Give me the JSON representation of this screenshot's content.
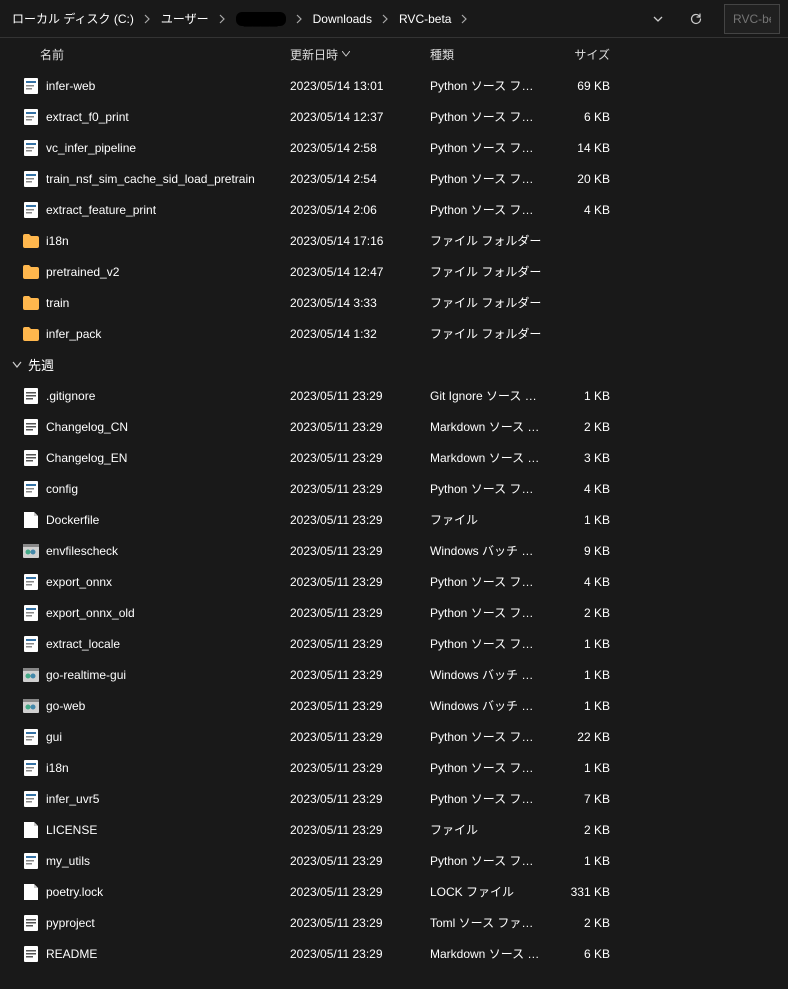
{
  "breadcrumb": [
    {
      "label": "ローカル ディスク (C:)"
    },
    {
      "label": "ユーザー"
    },
    {
      "label": "████",
      "hidden": true
    },
    {
      "label": "Downloads"
    },
    {
      "label": "RVC-beta"
    }
  ],
  "search_placeholder": "RVC-beta",
  "columns": {
    "name": "名前",
    "date": "更新日時",
    "type": "種類",
    "size": "サイズ"
  },
  "groups": [
    {
      "label": null,
      "items": [
        {
          "icon": "py",
          "name": "infer-web",
          "date": "2023/05/14 13:01",
          "type": "Python ソース ファイル",
          "size": "69 KB"
        },
        {
          "icon": "py",
          "name": "extract_f0_print",
          "date": "2023/05/14 12:37",
          "type": "Python ソース ファイル",
          "size": "6 KB"
        },
        {
          "icon": "py",
          "name": "vc_infer_pipeline",
          "date": "2023/05/14 2:58",
          "type": "Python ソース ファイル",
          "size": "14 KB"
        },
        {
          "icon": "py",
          "name": "train_nsf_sim_cache_sid_load_pretrain",
          "date": "2023/05/14 2:54",
          "type": "Python ソース ファイル",
          "size": "20 KB"
        },
        {
          "icon": "py",
          "name": "extract_feature_print",
          "date": "2023/05/14 2:06",
          "type": "Python ソース ファイル",
          "size": "4 KB"
        },
        {
          "icon": "folder",
          "name": "i18n",
          "date": "2023/05/14 17:16",
          "type": "ファイル フォルダー",
          "size": ""
        },
        {
          "icon": "folder",
          "name": "pretrained_v2",
          "date": "2023/05/14 12:47",
          "type": "ファイル フォルダー",
          "size": ""
        },
        {
          "icon": "folder",
          "name": "train",
          "date": "2023/05/14 3:33",
          "type": "ファイル フォルダー",
          "size": ""
        },
        {
          "icon": "folder",
          "name": "infer_pack",
          "date": "2023/05/14 1:32",
          "type": "ファイル フォルダー",
          "size": ""
        }
      ]
    },
    {
      "label": "先週",
      "items": [
        {
          "icon": "git",
          "name": ".gitignore",
          "date": "2023/05/11 23:29",
          "type": "Git Ignore ソース フ…",
          "size": "1 KB"
        },
        {
          "icon": "md",
          "name": "Changelog_CN",
          "date": "2023/05/11 23:29",
          "type": "Markdown ソース フ…",
          "size": "2 KB"
        },
        {
          "icon": "md",
          "name": "Changelog_EN",
          "date": "2023/05/11 23:29",
          "type": "Markdown ソース フ…",
          "size": "3 KB"
        },
        {
          "icon": "py",
          "name": "config",
          "date": "2023/05/11 23:29",
          "type": "Python ソース ファイル",
          "size": "4 KB"
        },
        {
          "icon": "file",
          "name": "Dockerfile",
          "date": "2023/05/11 23:29",
          "type": "ファイル",
          "size": "1 KB"
        },
        {
          "icon": "bat",
          "name": "envfilescheck",
          "date": "2023/05/11 23:29",
          "type": "Windows バッチ ファ…",
          "size": "9 KB"
        },
        {
          "icon": "py",
          "name": "export_onnx",
          "date": "2023/05/11 23:29",
          "type": "Python ソース ファイル",
          "size": "4 KB"
        },
        {
          "icon": "py",
          "name": "export_onnx_old",
          "date": "2023/05/11 23:29",
          "type": "Python ソース ファイル",
          "size": "2 KB"
        },
        {
          "icon": "py",
          "name": "extract_locale",
          "date": "2023/05/11 23:29",
          "type": "Python ソース ファイル",
          "size": "1 KB"
        },
        {
          "icon": "bat",
          "name": "go-realtime-gui",
          "date": "2023/05/11 23:29",
          "type": "Windows バッチ ファ…",
          "size": "1 KB"
        },
        {
          "icon": "bat",
          "name": "go-web",
          "date": "2023/05/11 23:29",
          "type": "Windows バッチ ファ…",
          "size": "1 KB",
          "highlight": true
        },
        {
          "icon": "py",
          "name": "gui",
          "date": "2023/05/11 23:29",
          "type": "Python ソース ファイル",
          "size": "22 KB"
        },
        {
          "icon": "py",
          "name": "i18n",
          "date": "2023/05/11 23:29",
          "type": "Python ソース ファイル",
          "size": "1 KB"
        },
        {
          "icon": "py",
          "name": "infer_uvr5",
          "date": "2023/05/11 23:29",
          "type": "Python ソース ファイル",
          "size": "7 KB"
        },
        {
          "icon": "file",
          "name": "LICENSE",
          "date": "2023/05/11 23:29",
          "type": "ファイル",
          "size": "2 KB"
        },
        {
          "icon": "py",
          "name": "my_utils",
          "date": "2023/05/11 23:29",
          "type": "Python ソース ファイル",
          "size": "1 KB"
        },
        {
          "icon": "file",
          "name": "poetry.lock",
          "date": "2023/05/11 23:29",
          "type": "LOCK ファイル",
          "size": "331 KB"
        },
        {
          "icon": "toml",
          "name": "pyproject",
          "date": "2023/05/11 23:29",
          "type": "Toml ソース ファイル",
          "size": "2 KB"
        },
        {
          "icon": "md",
          "name": "README",
          "date": "2023/05/11 23:29",
          "type": "Markdown ソース フ…",
          "size": "6 KB"
        }
      ]
    }
  ]
}
